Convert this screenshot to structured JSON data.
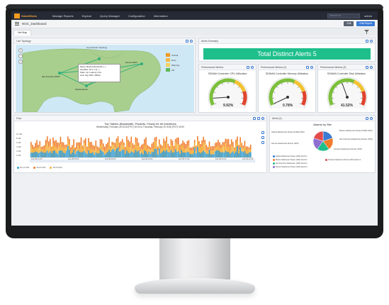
{
  "nav": {
    "brand": "SolarWinds",
    "items": [
      "Manage Reports",
      "Explore",
      "Query Manager",
      "Configuration",
      "Information"
    ],
    "search_placeholder": "Search for",
    "user": "admin"
  },
  "page": {
    "title": "NOC_Dashboard",
    "edit_label": "Edit",
    "export_label": "Edit Report"
  },
  "tabs": [
    "Net Map"
  ],
  "widgets": {
    "topology": {
      "title": "Live Topology",
      "map_title": "Core Router Topology",
      "tooltip": [
        "Name: Boston-Router01.[...]",
        "Interface: 10.1.1.1[...]",
        "Stats: Up; Latency 2ms",
        "Link: Gig 1/0/1 (100%)"
      ],
      "legend": [
        {
          "label": "Critical",
          "color": "#f29a1f"
        },
        {
          "label": "Error",
          "color": "#f5b942"
        },
        {
          "label": "Warning",
          "color": "#f7d15c"
        },
        {
          "label": "OK",
          "color": "#5fb85a"
        }
      ],
      "nodes": [
        "Boston-Router01",
        "San Francisco-Rtr01",
        "Denver-Rtr02",
        "Atlanta-Router",
        "Houston-Rtr03"
      ]
    },
    "alerts": {
      "title": "Alerts Summary",
      "banner": "Total Distinct Alerts 5"
    },
    "gauges": [
      {
        "header": "Performance Metrics",
        "title": "SDWAN Controller CPU Utilization",
        "value": "9.92%",
        "pct": 9.92
      },
      {
        "header": "Performance Metrics (2)",
        "title": "SDWAN Controller Memory Utilization",
        "value": "0.78%",
        "pct": 0.78
      },
      {
        "header": "Performance Metrics (3)",
        "title": "SDWAN Controller Disk Utilization",
        "value": "41.52%",
        "pct": 41.52
      }
    ],
    "flow": {
      "title": "Flow",
      "chart_title": "Top Talkers (Bandwidth, Packets, Flows) for All Interfaces",
      "chart_sub": "Wednesday, February 28 2018 (PST) 00:00 to Thursday, February 29 2018 (PST) 00:00",
      "yticks": [
        "10 GB",
        "8 GB",
        "6 GB",
        "4 GB",
        "2 GB",
        "0 GB"
      ],
      "xticks": [
        "Feb 28 01:00",
        "Feb 28 05:00",
        "Feb 28 09:00",
        "Feb 28 13:00",
        "Feb 28 17:00",
        "Feb 28 21:00",
        "Feb 29 01:00"
      ],
      "legend": [
        {
          "label": "10.1.0.101",
          "color": "#2f9fd8"
        },
        {
          "label": "10.2.0.101",
          "color": "#f07c2b"
        },
        {
          "label": "10.3.0.102",
          "color": "#f6b23a"
        }
      ]
    },
    "alerts_pie": {
      "title": "Alerts (1)",
      "chart_title": "Alarms by Site",
      "labels": [
        "Atlanta-DataCenter-Router.ACME (20%)",
        "Boston-DataCenter-Router.ACME (20%)",
        "San Francisco-DataCenter-Router (20%)",
        "Denver-DataCenter-Router (20%)",
        "Houston-DataCenter-Router (20%)"
      ],
      "legend": [
        "Atlanta DataCenter Router (20%) Alerts=1",
        "Boston DataCenter Router (20%) Alerts=1",
        "San Francisco DataCenter (20%) Alerts=1",
        "Denver DataCenter Router (20%) Alerts=1",
        "Houston DataCenter Router (20%) Alerts=1"
      ],
      "colors": [
        "#3a7bd5",
        "#f07c2b",
        "#1fbf8c",
        "#8e6fd0",
        "#e34b4b"
      ]
    }
  }
}
